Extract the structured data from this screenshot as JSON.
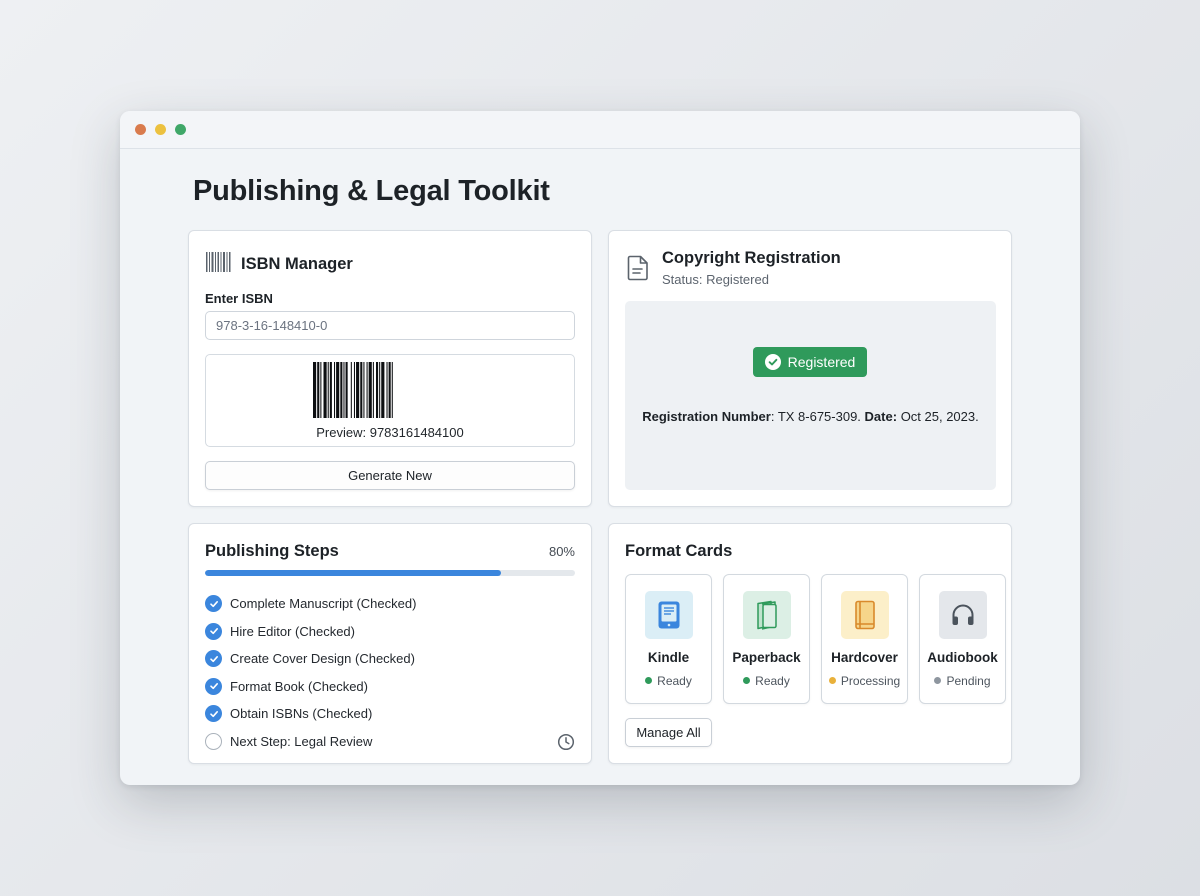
{
  "window": {
    "controls": [
      "close",
      "minimize",
      "maximize"
    ]
  },
  "page": {
    "title": "Publishing & Legal Toolkit"
  },
  "isbn": {
    "title": "ISBN Manager",
    "icon": "barcode-icon",
    "input_label": "Enter ISBN",
    "input_placeholder": "978-3-16-148410-0",
    "preview": "Preview: 9783161484100",
    "generate_label": "Generate New"
  },
  "copyright": {
    "title": "Copyright Registration",
    "icon": "document-icon",
    "status": "Status: Registered",
    "badge": "Registered",
    "registration_label": "Registration Number",
    "registration_value": ": TX 8-675-309.",
    "date_label": "Date:",
    "date_value": "Oct 25, 2023."
  },
  "steps": {
    "title": "Publishing Steps",
    "percent_label": "80%",
    "progress": 0.8,
    "items": [
      {
        "label": "Complete Manuscript (Checked)",
        "done": true
      },
      {
        "label": "Hire Editor (Checked)",
        "done": true
      },
      {
        "label": "Create Cover Design (Checked)",
        "done": true
      },
      {
        "label": "Format Book (Checked)",
        "done": true
      },
      {
        "label": "Obtain ISBNs (Checked)",
        "done": true
      },
      {
        "label": "Next Step: Legal Review",
        "done": false
      }
    ]
  },
  "formats": {
    "title": "Format Cards",
    "items": [
      {
        "name": "Kindle",
        "status": "Ready",
        "icon": "ereader-icon",
        "status_color": "#2f9a5b",
        "bg": "#dbeef6"
      },
      {
        "name": "Paperback",
        "status": "Ready",
        "icon": "paperback-icon",
        "status_color": "#2f9a5b",
        "bg": "#dcefe5"
      },
      {
        "name": "Hardcover",
        "status": "Processing",
        "icon": "hardcover-icon",
        "status_color": "#e9b13b",
        "bg": "#fcefc9"
      },
      {
        "name": "Audiobook",
        "status": "Pending",
        "icon": "headphones-icon",
        "status_color": "#8e969f",
        "bg": "#e4e7eb"
      }
    ],
    "manage_label": "Manage All"
  },
  "colors": {
    "accent": "#3b86dd",
    "success": "#2f9a5b",
    "warning": "#e9b13b",
    "neutral": "#8e969f"
  }
}
